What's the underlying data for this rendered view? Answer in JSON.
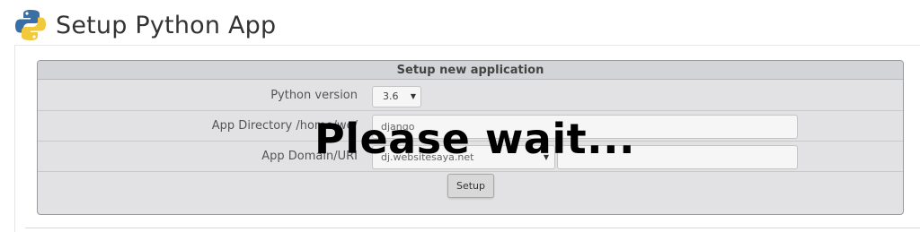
{
  "header": {
    "title": "Setup Python App",
    "logo_icon": "python-logo-icon"
  },
  "panel": {
    "heading": "Setup new application",
    "rows": [
      {
        "label": "Python version",
        "control": "select",
        "value": "3.6"
      },
      {
        "label": "App Directory /home/we",
        "label_suffix": "/",
        "control": "text",
        "value": "django"
      },
      {
        "label": "App Domain/URI",
        "control": "select+text",
        "value": "dj.websitesaya.net",
        "path_value": ""
      }
    ],
    "submit_label": "Setup"
  },
  "overlay": {
    "text": "Please wait..."
  },
  "colors": {
    "panel_bg": "#e2e2e4",
    "heading_bg": "#d3d4d7",
    "python_blue": "#3a6fa6",
    "python_yellow": "#f2c93b"
  }
}
